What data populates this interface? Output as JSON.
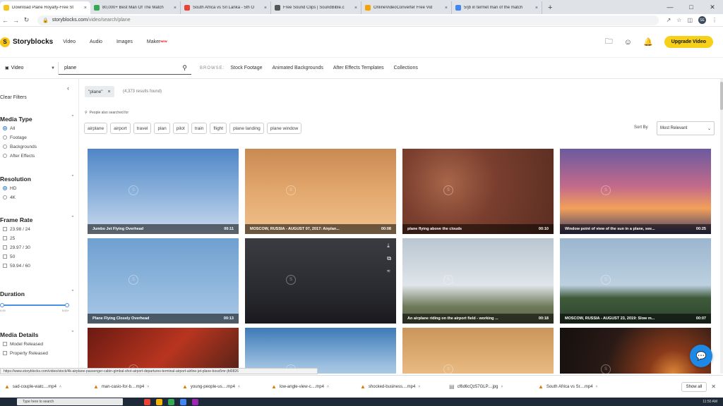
{
  "browser": {
    "tabs": [
      {
        "title": "Download Plane Royalty-Free St",
        "active": true,
        "color": "#f5c518"
      },
      {
        "title": "80,000+ Best Man Of The Match",
        "active": false,
        "color": "#34a853"
      },
      {
        "title": "South Africa vs Sri Lanka - 5th O",
        "active": false,
        "color": "#ea4335"
      },
      {
        "title": "Free Sound Clips | SoundBible.c",
        "active": false,
        "color": "#555555"
      },
      {
        "title": "OnlineVideoConverter Free Vid",
        "active": false,
        "color": "#f4a300"
      },
      {
        "title": "5rjb in termet man of the match",
        "active": false,
        "color": "#4285f4"
      }
    ],
    "new_tab": "+",
    "url_host": "storyblocks.com",
    "url_path": "/video/search/plane",
    "profile": "SE"
  },
  "site": {
    "logo_mark": "S",
    "logo_text": "Storyblocks",
    "nav": [
      "Video",
      "Audio",
      "Images"
    ],
    "nav_maker": "Maker",
    "nav_maker_badge": "NEW",
    "upgrade_label": "Upgrade Video"
  },
  "search": {
    "type_label": "Video",
    "query": "plane",
    "browse_label": "BROWSE:",
    "browse_links": [
      "Stock Footage",
      "Animated Backgrounds",
      "After Effects Templates",
      "Collections"
    ]
  },
  "sidebar": {
    "clear_filters": "Clear Filters",
    "media_type": {
      "title": "Media Type",
      "options": [
        "All",
        "Footage",
        "Backgrounds",
        "After Effects"
      ],
      "selected": 0
    },
    "resolution": {
      "title": "Resolution",
      "options": [
        "HD",
        "4K"
      ],
      "selected": 0
    },
    "frame_rate": {
      "title": "Frame Rate",
      "options": [
        "23.98 / 24",
        "25",
        "29.97 / 30",
        "50",
        "59.94 / 60"
      ]
    },
    "duration": {
      "title": "Duration",
      "min_label": "0:00",
      "max_label": "5:00+",
      "range": [
        0,
        1
      ]
    },
    "media_details": {
      "title": "Media Details",
      "options": [
        "Model Released",
        "Property Released"
      ]
    }
  },
  "results": {
    "query_chip": "\"plane\"",
    "count_text": "(4,373 results found)",
    "people_also": "People also searched for",
    "related_tags": [
      "airplane",
      "airport",
      "travel",
      "plan",
      "pilot",
      "train",
      "flight",
      "plane landing",
      "plane window"
    ],
    "sort_label": "Sort By",
    "sort_value": "Most Relevant",
    "items": [
      {
        "title": "Jumbo Jet Flying Overhead",
        "duration": "00:11",
        "scene": "sky-jet"
      },
      {
        "title": "MOSCOW, RUSSIA - AUGUST 07, 2017: Airplan...",
        "duration": "00:08",
        "scene": "sunset-silhouette"
      },
      {
        "title": "plane flying above the clouds",
        "duration": "00:10",
        "scene": "clouds-plane"
      },
      {
        "title": "Window point of view of the sun in a plane, see...",
        "duration": "00:25",
        "scene": "window-wing"
      },
      {
        "title": "Plane Flying Closely Overhead",
        "duration": "00:13",
        "scene": "sky-climb"
      },
      {
        "title": "",
        "duration": "",
        "scene": "cabin-aisle"
      },
      {
        "title": "An airplane riding on the airport field - working ...",
        "duration": "00:18",
        "scene": "runway-engine"
      },
      {
        "title": "MOSCOW, RUSSIA - AUGUST 23, 2019: Slow m...",
        "duration": "00:07",
        "scene": "takeoff-forest"
      },
      {
        "title": "",
        "duration": "",
        "scene": "passport"
      },
      {
        "title": "",
        "duration": "",
        "scene": "above-clouds"
      },
      {
        "title": "",
        "duration": "",
        "scene": "golden-runway"
      },
      {
        "title": "",
        "duration": "",
        "scene": "night-fire"
      }
    ]
  },
  "status_url": "https://www.storyblocks.com/video/stock/4k-airplane-passenger-cabin-gimbal-shot-airport-departures-terminal-airport-airline-jet-plane-boss5mr-jfd0826",
  "downloads": {
    "items": [
      {
        "name": "sad-couple-watc....mp4",
        "kind": "video"
      },
      {
        "name": "man-casio-for-b....mp4",
        "kind": "video"
      },
      {
        "name": "young-people-us....mp4",
        "kind": "video"
      },
      {
        "name": "low-angle-view-c....mp4",
        "kind": "video"
      },
      {
        "name": "shocked-business....mp4",
        "kind": "video"
      },
      {
        "name": "cf6d6cQz57GLP....jpg",
        "kind": "image"
      },
      {
        "name": "South Africa vs Sr....mp4",
        "kind": "video"
      }
    ],
    "show_all": "Show all"
  },
  "taskbar": {
    "search_placeholder": "Type here to search",
    "clock": "11:50 AM"
  }
}
